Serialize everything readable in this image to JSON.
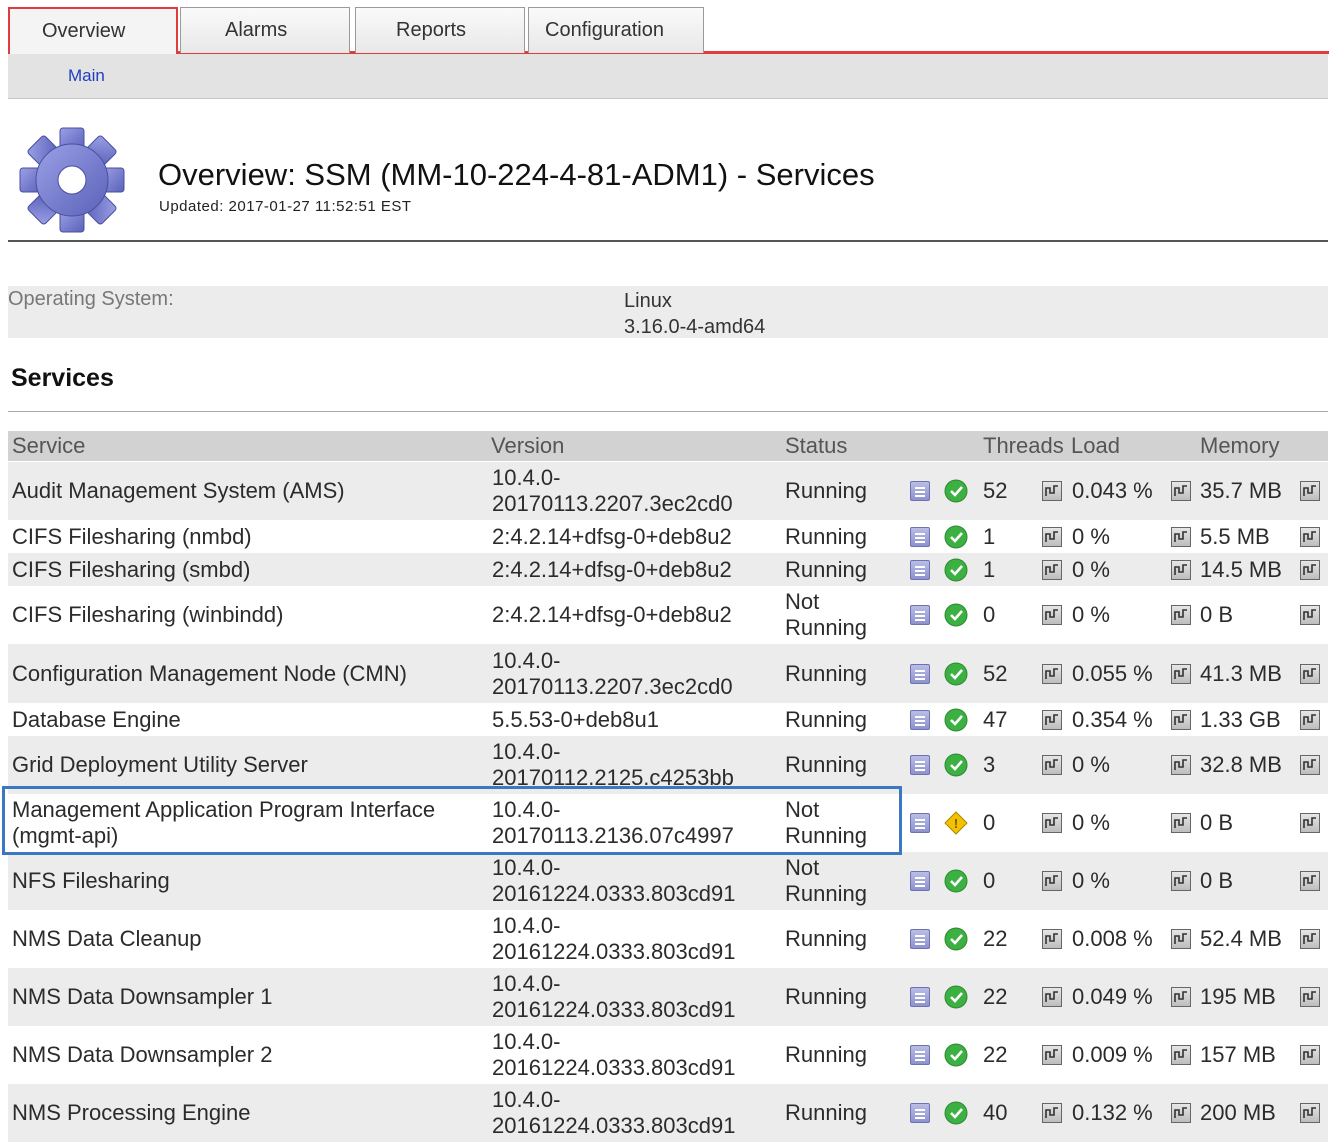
{
  "tabs": [
    {
      "label": "Overview",
      "active": true
    },
    {
      "label": "Alarms",
      "active": false
    },
    {
      "label": "Reports",
      "active": false
    },
    {
      "label": "Configuration",
      "active": false
    }
  ],
  "subnav": {
    "main": "Main"
  },
  "header": {
    "title": "Overview: SSM (MM-10-224-4-81-ADM1) - Services",
    "updated": "Updated: 2017-01-27 11:52:51 EST",
    "icon": "gear-icon"
  },
  "os": {
    "label": "Operating System:",
    "value_line1": "Linux",
    "value_line2": "3.16.0-4-amd64"
  },
  "services_heading": "Services",
  "columns": {
    "service": "Service",
    "version": "Version",
    "status": "Status",
    "threads": "Threads",
    "load": "Load",
    "memory": "Memory"
  },
  "rows": [
    {
      "service": [
        "Audit Management System (AMS)"
      ],
      "version": [
        "10.4.0-",
        "20170113.2207.3ec2cd0"
      ],
      "status": [
        "Running"
      ],
      "state": "ok",
      "threads": "52",
      "load": "0.043 %",
      "memory": "35.7 MB"
    },
    {
      "service": [
        "CIFS Filesharing (nmbd)"
      ],
      "version": [
        "2:4.2.14+dfsg-0+deb8u2"
      ],
      "status": [
        "Running"
      ],
      "state": "ok",
      "threads": "1",
      "load": "0 %",
      "memory": "5.5 MB"
    },
    {
      "service": [
        "CIFS Filesharing (smbd)"
      ],
      "version": [
        "2:4.2.14+dfsg-0+deb8u2"
      ],
      "status": [
        "Running"
      ],
      "state": "ok",
      "threads": "1",
      "load": "0 %",
      "memory": "14.5 MB"
    },
    {
      "service": [
        "CIFS Filesharing (winbindd)"
      ],
      "version": [
        "2:4.2.14+dfsg-0+deb8u2"
      ],
      "status": [
        "Not",
        "Running"
      ],
      "state": "ok",
      "threads": "0",
      "load": "0 %",
      "memory": "0 B"
    },
    {
      "service": [
        "Configuration Management Node (CMN)"
      ],
      "version": [
        "10.4.0-",
        "20170113.2207.3ec2cd0"
      ],
      "status": [
        "Running"
      ],
      "state": "ok",
      "threads": "52",
      "load": "0.055 %",
      "memory": "41.3 MB"
    },
    {
      "service": [
        "Database Engine"
      ],
      "version": [
        "5.5.53-0+deb8u1"
      ],
      "status": [
        "Running"
      ],
      "state": "ok",
      "threads": "47",
      "load": "0.354 %",
      "memory": "1.33 GB"
    },
    {
      "service": [
        "Grid Deployment Utility Server"
      ],
      "version": [
        "10.4.0-",
        "20170112.2125.c4253bb"
      ],
      "status": [
        "Running"
      ],
      "state": "ok",
      "threads": "3",
      "load": "0 %",
      "memory": "32.8 MB"
    },
    {
      "service": [
        "Management Application Program Interface",
        "(mgmt-api)"
      ],
      "version": [
        "10.4.0-",
        "20170113.2136.07c4997"
      ],
      "status": [
        "Not",
        "Running"
      ],
      "state": "warn",
      "threads": "0",
      "load": "0 %",
      "memory": "0 B"
    },
    {
      "service": [
        "NFS Filesharing"
      ],
      "version": [
        "10.4.0-",
        "20161224.0333.803cd91"
      ],
      "status": [
        "Not",
        "Running"
      ],
      "state": "ok",
      "threads": "0",
      "load": "0 %",
      "memory": "0 B"
    },
    {
      "service": [
        "NMS Data Cleanup"
      ],
      "version": [
        "10.4.0-",
        "20161224.0333.803cd91"
      ],
      "status": [
        "Running"
      ],
      "state": "ok",
      "threads": "22",
      "load": "0.008 %",
      "memory": "52.4 MB"
    },
    {
      "service": [
        "NMS Data Downsampler 1"
      ],
      "version": [
        "10.4.0-",
        "20161224.0333.803cd91"
      ],
      "status": [
        "Running"
      ],
      "state": "ok",
      "threads": "22",
      "load": "0.049 %",
      "memory": "195 MB"
    },
    {
      "service": [
        "NMS Data Downsampler 2"
      ],
      "version": [
        "10.4.0-",
        "20161224.0333.803cd91"
      ],
      "status": [
        "Running"
      ],
      "state": "ok",
      "threads": "22",
      "load": "0.009 %",
      "memory": "157 MB"
    },
    {
      "service": [
        "NMS Processing Engine"
      ],
      "version": [
        "10.4.0-",
        "20161224.0333.803cd91"
      ],
      "status": [
        "Running"
      ],
      "state": "ok",
      "threads": "40",
      "load": "0.132 %",
      "memory": "200 MB"
    }
  ],
  "colors": {
    "accent": "#e03c3c",
    "ok": "#3cb043",
    "warn": "#f2c200",
    "highlight": "#3b78c4",
    "link": "#1d3fbf"
  }
}
